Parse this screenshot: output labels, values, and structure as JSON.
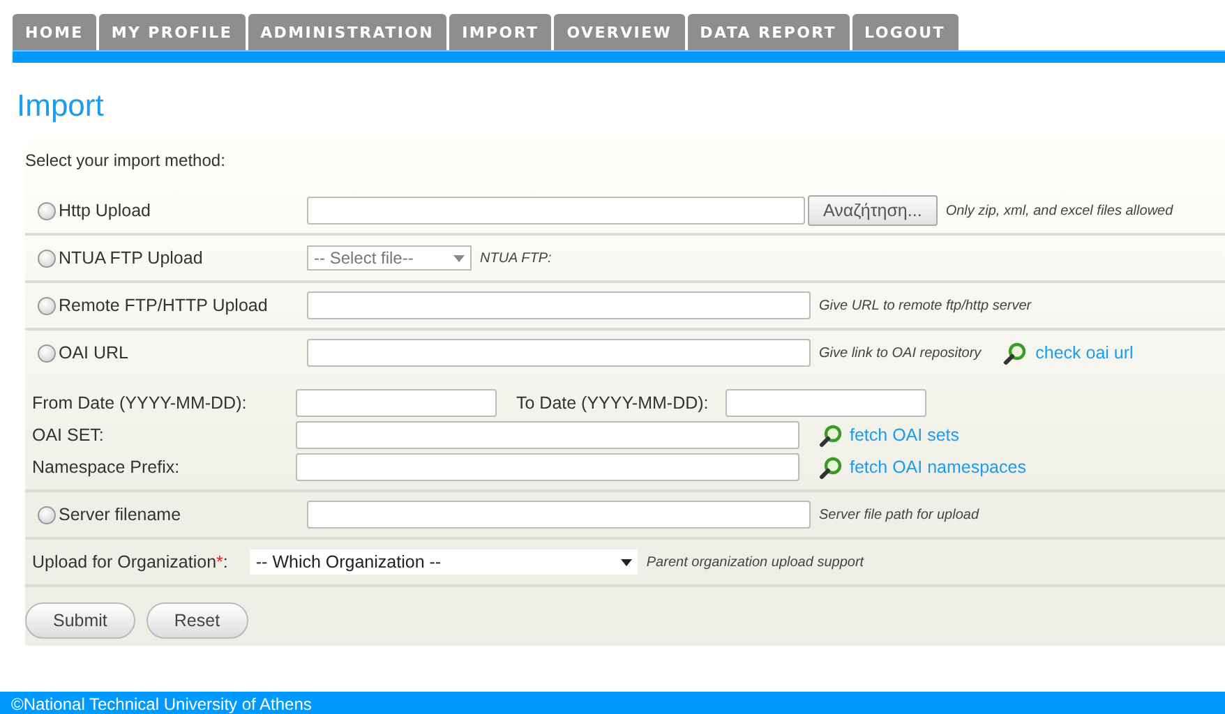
{
  "nav": {
    "tabs": [
      {
        "label": "HOME"
      },
      {
        "label": "MY PROFILE"
      },
      {
        "label": "ADMINISTRATION"
      },
      {
        "label": "IMPORT"
      },
      {
        "label": "OVERVIEW"
      },
      {
        "label": "DATA REPORT"
      },
      {
        "label": "LOGOUT"
      }
    ]
  },
  "title": "Import",
  "form": {
    "intro": "Select your import method:",
    "methods": [
      {
        "kind": "file",
        "label": "Http Upload",
        "selected": false,
        "button": "Αναζήτηση...",
        "hint": "Only zip, xml, and excel files allowed"
      },
      {
        "kind": "select",
        "label": "NTUA FTP Upload",
        "selected": false,
        "value": "-- Select file--",
        "hint": "NTUA FTP:"
      },
      {
        "kind": "text",
        "label": "Remote FTP/HTTP Upload",
        "selected": false,
        "hint": "Give URL to remote ftp/http server"
      },
      {
        "kind": "oai",
        "label": "OAI URL",
        "selected": false,
        "hint": "Give link to OAI repository",
        "link": "check oai url",
        "options": {
          "from_label": "From Date (YYYY-MM-DD):",
          "to_label": "To Date (YYYY-MM-DD):",
          "set_label": "OAI SET:",
          "set_link": "fetch OAI sets",
          "prefix_label": "Namespace Prefix:",
          "prefix_link": "fetch OAI namespaces"
        }
      },
      {
        "kind": "text",
        "label": "Server filename",
        "selected": false,
        "hint": "Server file path for upload"
      }
    ],
    "organization": {
      "label": "Upload for Organization",
      "required_mark": "*",
      "label_end": ":",
      "value": "-- Which Organization --",
      "hint": "Parent organization upload support"
    },
    "buttons": [
      "Submit",
      "Reset"
    ]
  },
  "footer": "©National Technical University of Athens"
}
